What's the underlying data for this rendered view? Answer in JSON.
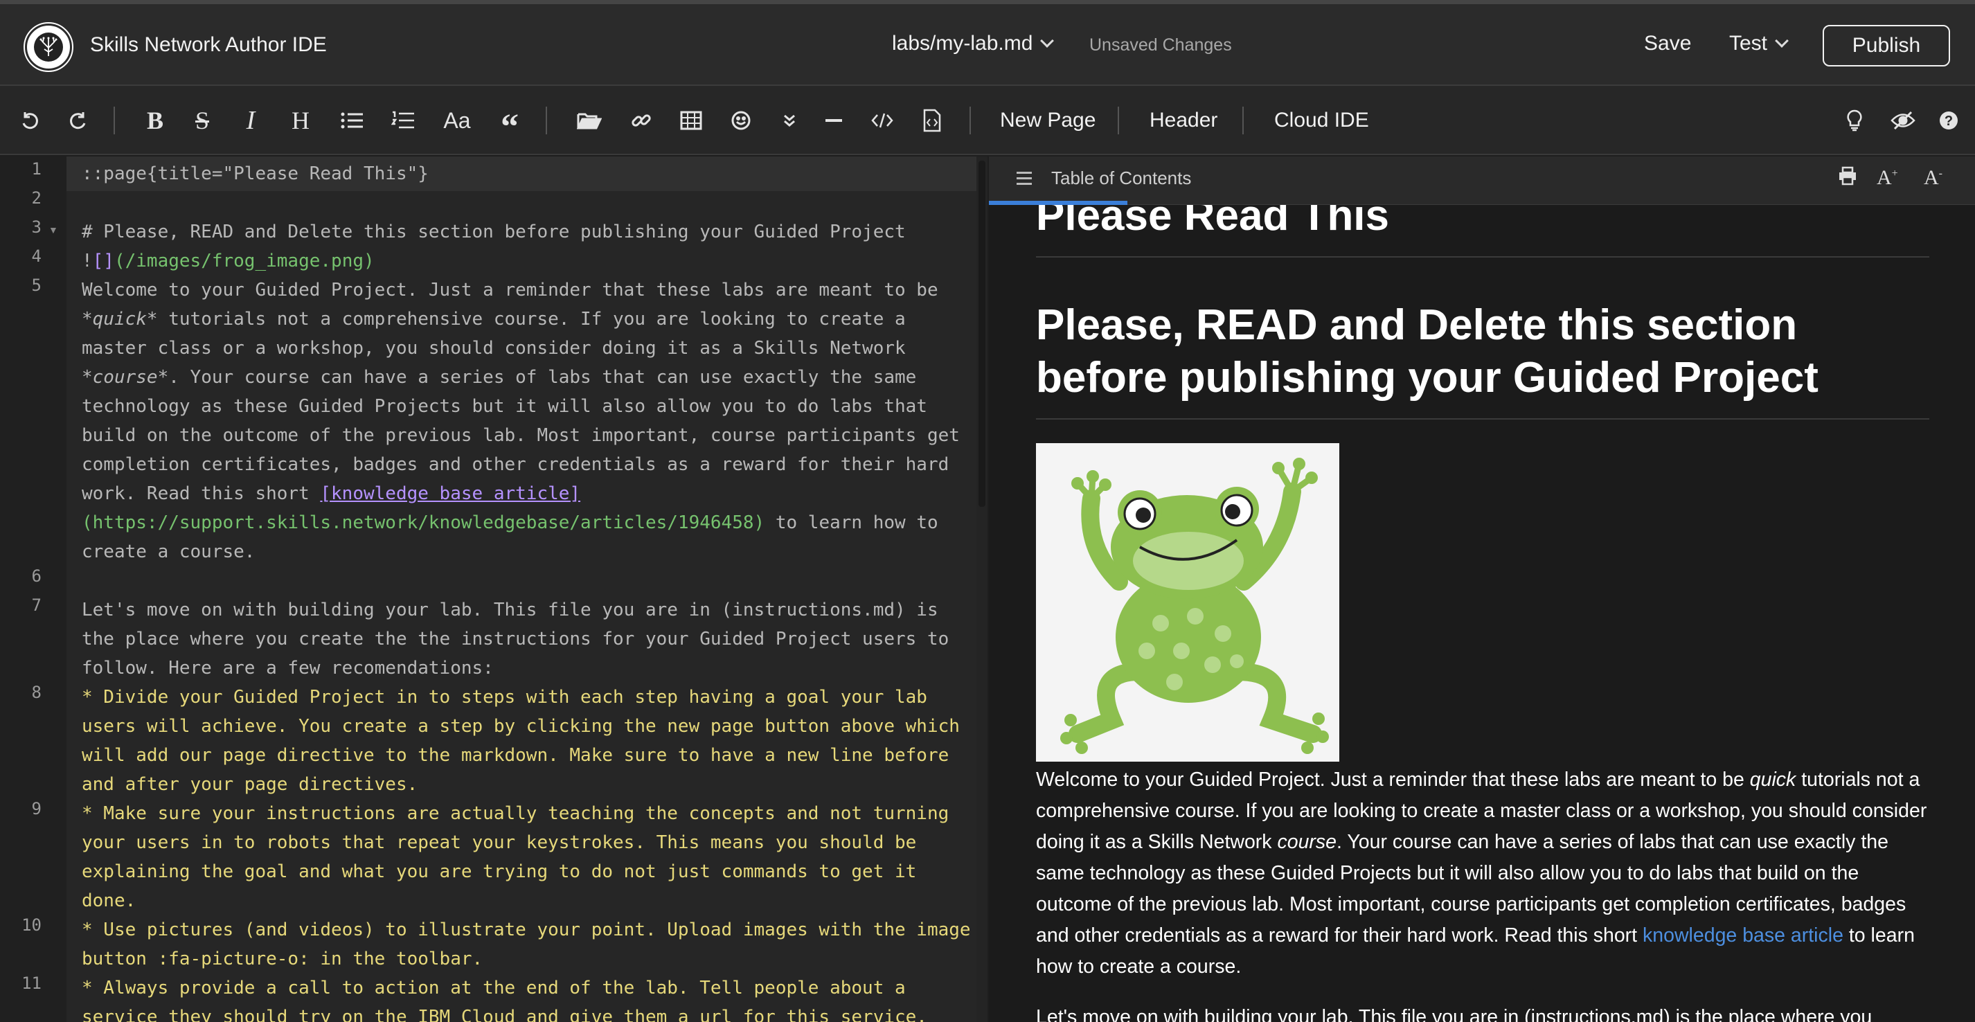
{
  "header": {
    "app_title": "Skills Network Author IDE",
    "file_name": "labs/my-lab.md",
    "status": "Unsaved Changes",
    "save_label": "Save",
    "test_label": "Test",
    "publish_label": "Publish"
  },
  "toolbar": {
    "new_page": "New Page",
    "header": "Header",
    "cloud_ide": "Cloud IDE",
    "font_size_label": "Aa"
  },
  "editor": {
    "line_numbers": [
      "1",
      "2",
      "3",
      "4",
      "5",
      "6",
      "7",
      "8",
      "9",
      "10",
      "11"
    ],
    "lines": {
      "l1": "::page{title=\"Please Read This\"}",
      "l3": "# Please, READ and Delete this section before publishing your Guided Project",
      "l4_bang": "!",
      "l4_brackets": "[]",
      "l4_path": "(/images/frog_image.png)",
      "l5a": "Welcome to your Guided Project. Just a reminder that these labs are meant to be",
      "l5b_em": "*quick*",
      "l5b": " tutorials not a comprehensive course. If you are looking to create a",
      "l5c": "master class or a workshop, you should consider doing it as a Skills Network",
      "l5d_em": "*course*",
      "l5d": ". Your course can have a series of labs that can use exactly the same",
      "l5e": "technology as these Guided Projects but it will also allow you to do labs that",
      "l5f": "build on the outcome of the previous lab. Most important, course participants get",
      "l5g": "completion certificates, badges and other credentials as a reward for their hard",
      "l5h": "work. Read this short ",
      "l5h_link": "[knowledge base article]",
      "l5i_url": "(https://support.skills.network/knowledgebase/articles/1946458)",
      "l5i": " to learn how to",
      "l5j": "create a course.",
      "l7a": "Let's move on with building your lab. This file you are in (instructions.md) is",
      "l7b": "the place where you create the the instructions for your Guided Project users to",
      "l7c": "follow. Here are a few recomendations:",
      "l8a": "* Divide your Guided Project in to steps with each step having a goal your lab",
      "l8b": "users will achieve. You create a step by clicking the new page button above which",
      "l8c": "will add our page directive to the markdown. Make sure to have a new line before",
      "l8d": "and after your page directives.",
      "l9a": "* Make sure your instructions are actually teaching the concepts and not turning",
      "l9b": "your users in to robots that repeat your keystrokes. This means you should be",
      "l9c": "explaining the goal and what you are trying to do not just commands to get it",
      "l9d": "done.",
      "l10a": "* Use pictures (and videos) to illustrate your point. Upload images with the image",
      "l10b": "button :fa-picture-o: in the toolbar.",
      "l11a": "* Always provide a call to action at the end of the lab. Tell people about a",
      "l11b": "service they should try on the IBM Cloud and give them a url for this service."
    }
  },
  "preview": {
    "toc_title": "Table of Contents",
    "page_title": "Please Read This",
    "section_title": "Please, READ and Delete this section before publishing your Guided Project",
    "p1_a": "Welcome to your Guided Project. Just a reminder that these labs are meant to be ",
    "p1_em1": "quick",
    "p1_b": " tutorials not a comprehensive course. If you are looking to create a master class or a workshop, you should consider doing it as a Skills Network ",
    "p1_em2": "course",
    "p1_c": ". Your course can have a series of labs that can use exactly the same technology as these Guided Projects but it will also allow you to do labs that build on the outcome of the previous lab. Most important, course participants get completion certificates, badges and other credentials as a reward for their hard work. Read this short ",
    "p1_link": "knowledge base article",
    "p1_d": " to learn how to create a course.",
    "p2": "Let's move on with building your lab. This file you are in (instructions.md) is the place where you create"
  },
  "colors": {
    "accent": "#3b7fd9",
    "link": "#4d8fe0",
    "code_yellow": "#e6d87a",
    "code_url": "#76c26e",
    "code_link": "#b592ff"
  }
}
